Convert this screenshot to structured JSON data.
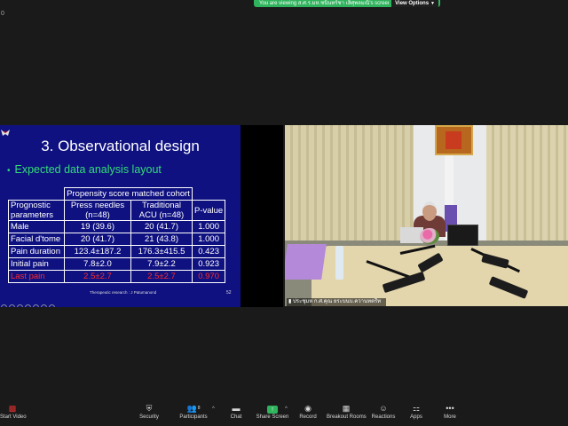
{
  "banner": {
    "message": "You are viewing ส.ศ.ร.มห.ชนินทร์ชา เลิศุพลมณิ's screen",
    "view_options": "View Options",
    "corner_mark": "0"
  },
  "slide": {
    "title": "3. Observational design",
    "bullet": "Expected data analysis layout",
    "table": {
      "group_header": "Propensity score matched cohort",
      "headers": [
        "Prognostic parameters",
        "Press needles (n=48)",
        "Traditional ACU (n=48)",
        "P-value"
      ],
      "rows": [
        [
          "Male",
          "19 (39.6)",
          "20 (41.7)",
          "1.000"
        ],
        [
          "Facial d'tome",
          "20 (41.7)",
          "21 (43.8)",
          "1.000"
        ],
        [
          "Pain duration",
          "123.4±187.2",
          "176.3±415.5",
          "0.423"
        ],
        [
          "Initial pain",
          "7.8±2.0",
          "7.9±2.2",
          "0.923"
        ],
        [
          "Last pain",
          "2.5±2.7",
          "2.5±2.7",
          "0.970"
        ]
      ],
      "highlight_color": "#ff2a2a"
    },
    "footer_left": "Therapeutic research : J Patumanond",
    "footer_right": "52",
    "background": "#0f1180",
    "bullet_color": "#33dd77"
  },
  "video": {
    "participant_name": "ประชุมห ก.ศ.คุณ ยระบนบ.ควานทตรีท"
  },
  "toolbar": {
    "items": [
      {
        "label": "Start Video",
        "icon": "video-off-icon"
      },
      {
        "label": "Security",
        "icon": "shield-icon"
      },
      {
        "label": "Participants",
        "icon": "participants-icon",
        "count": "8"
      },
      {
        "label": "Chat",
        "icon": "chat-icon"
      },
      {
        "label": "Share Screen",
        "icon": "share-screen-icon"
      },
      {
        "label": "Record",
        "icon": "record-icon"
      },
      {
        "label": "Breakout Rooms",
        "icon": "breakout-rooms-icon"
      },
      {
        "label": "Reactions",
        "icon": "reactions-icon"
      },
      {
        "label": "Apps",
        "icon": "apps-icon"
      },
      {
        "label": "More",
        "icon": "more-icon"
      }
    ],
    "accent_color": "#2fb35c"
  }
}
